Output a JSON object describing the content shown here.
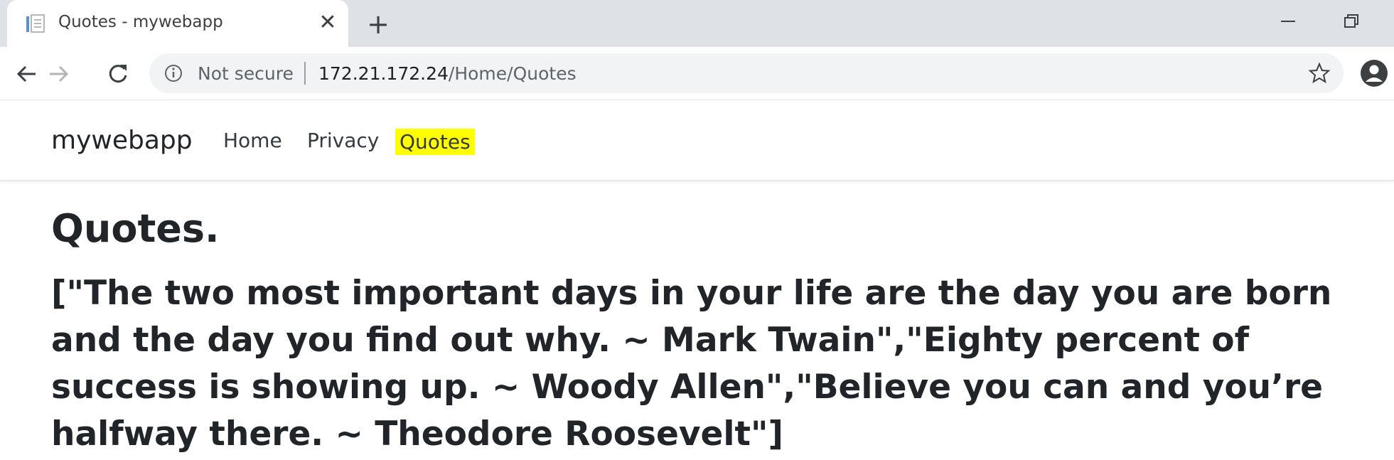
{
  "browser": {
    "tab_title": "Quotes - mywebapp",
    "tab_close": "✕",
    "new_tab": "+",
    "security_label": "Not secure",
    "url_host": "172.21.172.24",
    "url_path": "/Home/Quotes"
  },
  "navbar": {
    "brand": "mywebapp",
    "links": [
      {
        "label": "Home"
      },
      {
        "label": "Privacy"
      },
      {
        "label": "Quotes",
        "highlighted": true,
        "highlight_color": "#ffff00"
      }
    ]
  },
  "main": {
    "title": "Quotes.",
    "quotes_text": "[\"The two most important days in your life are the day you are born and the day you find out why. ~ Mark Twain\",\"Eighty percent of success is showing up. ~ Woody Allen\",\"Believe you can and you’re halfway there. ~ Theodore Roosevelt\"]"
  },
  "icons": [
    "page-favicon-icon",
    "close-icon",
    "plus-icon",
    "minimize-icon",
    "restore-icon",
    "back-arrow-icon",
    "forward-arrow-icon",
    "reload-icon",
    "info-icon",
    "star-icon",
    "profile-icon"
  ]
}
